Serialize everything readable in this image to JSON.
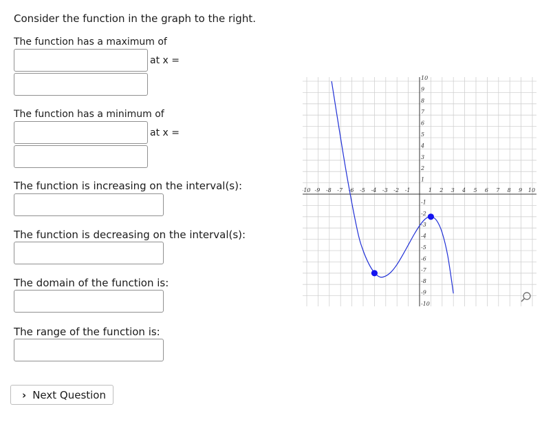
{
  "prompt": "Consider the function in the graph to the right.",
  "max": {
    "label": "The function has a maximum of",
    "at_label": "at x ="
  },
  "min": {
    "label": "The function has a minimum of",
    "at_label": "at x ="
  },
  "increasing": {
    "label": "The function is increasing on the interval(s):"
  },
  "decreasing": {
    "label": "The function is decreasing on the interval(s):"
  },
  "domain": {
    "label": "The domain of the function is:"
  },
  "range": {
    "label": "The range of the function is:"
  },
  "next_button": {
    "label": "Next Question"
  },
  "icons": {
    "next": "chevron-right-icon",
    "zoom": "magnifier-icon"
  },
  "colors": {
    "curve": "#1f2fd6",
    "point": "#1414f0",
    "grid": "#d0d0d0",
    "axis": "#333333"
  },
  "chart_data": {
    "type": "line",
    "x_ticks": [
      "-10",
      "-9",
      "-8",
      "-7",
      "-6",
      "-5",
      "-4",
      "-3",
      "-2",
      "-1",
      "1",
      "2",
      "3",
      "4",
      "5",
      "6",
      "7",
      "8",
      "9",
      "10"
    ],
    "y_ticks": [
      "10",
      "9",
      "8",
      "7",
      "6",
      "5",
      "4",
      "3",
      "2",
      "1",
      "-1",
      "-2",
      "-3",
      "-4",
      "-5",
      "-6",
      "-7",
      "-8",
      "-9",
      "-10"
    ],
    "xlim": [
      -10,
      10
    ],
    "ylim": [
      -10,
      10
    ],
    "grid": true,
    "series": [
      {
        "x": [
          -7.8,
          -6.5,
          -5.5,
          -5,
          -4.5,
          -4,
          -3.5,
          -3,
          -2.5,
          -2,
          -1.5,
          -1,
          -0.5,
          0,
          0.5,
          1,
          1.5,
          2,
          2.5,
          3
        ],
        "y": [
          10,
          1.96,
          -3.28,
          -5.0,
          -6.17,
          -6.96,
          -7.34,
          -7.25,
          -6.87,
          -6.23,
          -5.4,
          -4.5,
          -3.6,
          -2.8,
          -2.2,
          -2.0,
          -2.32,
          -3.4,
          -5.47,
          -8.79
        ]
      }
    ],
    "points": [
      {
        "x": -4,
        "y": -7
      },
      {
        "x": 1,
        "y": -2
      }
    ]
  }
}
